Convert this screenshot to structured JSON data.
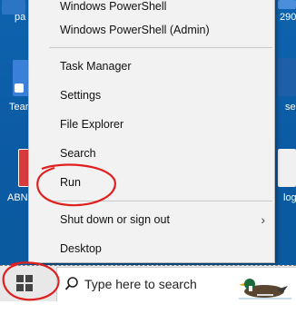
{
  "desktop": {
    "left_icons": [
      {
        "label": "pa"
      },
      {
        "label": "Tear"
      },
      {
        "label": "ABN"
      }
    ],
    "right_icons": [
      {
        "label": "290"
      },
      {
        "label": "se"
      },
      {
        "label": "log"
      }
    ]
  },
  "context_menu": {
    "items": [
      {
        "label": "Windows PowerShell",
        "id": "powershell"
      },
      {
        "label": "Windows PowerShell (Admin)",
        "id": "powershell-admin"
      },
      {
        "label": "Task Manager",
        "id": "task-manager"
      },
      {
        "label": "Settings",
        "id": "settings"
      },
      {
        "label": "File Explorer",
        "id": "file-explorer"
      },
      {
        "label": "Search",
        "id": "search"
      },
      {
        "label": "Run",
        "id": "run"
      },
      {
        "label": "Shut down or sign out",
        "id": "shutdown"
      },
      {
        "label": "Desktop",
        "id": "desktop"
      }
    ],
    "submenu_chevron": "›"
  },
  "taskbar": {
    "search_placeholder": "Type here to search",
    "start_icon": "windows-logo-icon",
    "search_icon": "magnifier-icon"
  },
  "colors": {
    "annotation": "#e02020",
    "desktop_blue": "#0c64b0",
    "menu_bg": "#f2f2f2"
  }
}
